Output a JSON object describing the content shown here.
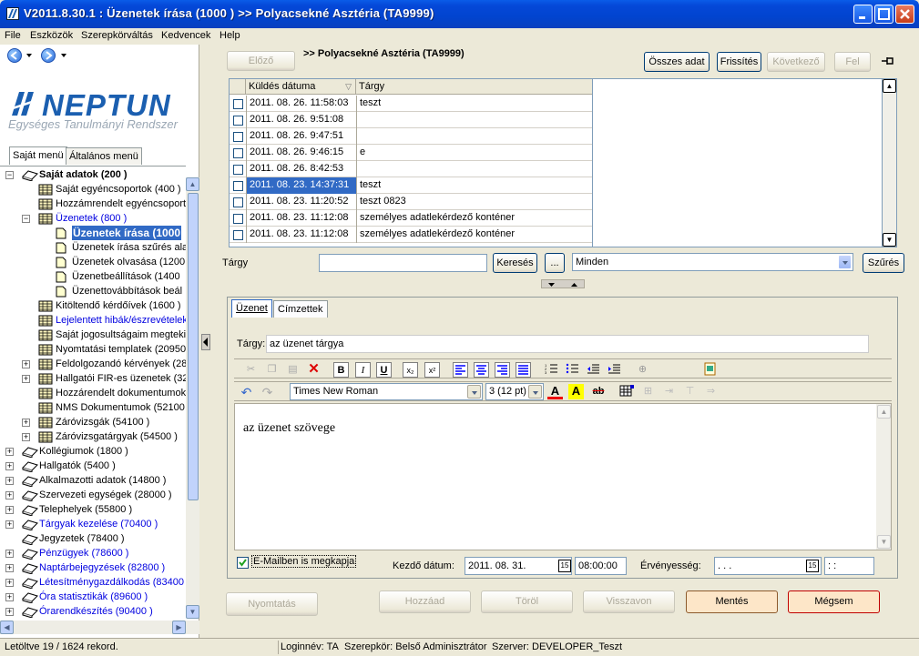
{
  "window": {
    "title": "V2011.8.30.1 : Üzenetek írása (1000  )  >> Polyacsekné Asztéria (TA9999)"
  },
  "menu": [
    "File",
    "Eszközök",
    "Szerepkörváltás",
    "Kedvencek",
    "Help"
  ],
  "logo": {
    "word": "NEPTUN",
    "sub": "Egységes Tanulmányi Rendszer"
  },
  "left_tabs": [
    "Saját menü",
    "Általános menü"
  ],
  "tree": [
    {
      "label": "Saját adatok (200  )",
      "level": 0,
      "bold": true,
      "exp": "−"
    },
    {
      "label": "Saját egyéncsoportok (400  )",
      "level": 1
    },
    {
      "label": "Hozzámrendelt egyéncsoporto",
      "level": 1
    },
    {
      "label": "Üzenetek (800  )",
      "level": 1,
      "blue": true,
      "exp": "−"
    },
    {
      "label": "Üzenetek írása (1000",
      "level": 2,
      "selected": true
    },
    {
      "label": "Üzenetek írása szűrés ala",
      "level": 2
    },
    {
      "label": "Üzenetek olvasása (1200",
      "level": 2
    },
    {
      "label": "Üzenetbeállítások (1400",
      "level": 2
    },
    {
      "label": "Üzenettovábbítások beál",
      "level": 2
    },
    {
      "label": "Kitöltendő kérdőívek (1600  )",
      "level": 1
    },
    {
      "label": "Lejelentett hibák/észrevételek",
      "level": 1,
      "blue": true
    },
    {
      "label": "Saját jogosultságaim megtekir",
      "level": 1
    },
    {
      "label": "Nyomtatási templatek (20950",
      "level": 1
    },
    {
      "label": "Feldolgozandó kérvények (28",
      "level": 1,
      "exp": "+"
    },
    {
      "label": "Hallgatói FIR-es üzenetek (32",
      "level": 1,
      "exp": "+"
    },
    {
      "label": "Hozzárendelt dokumentumok",
      "level": 1
    },
    {
      "label": "NMS Dokumentumok (52100",
      "level": 1
    },
    {
      "label": "Záróvizsgák (54100  )",
      "level": 1,
      "exp": "+"
    },
    {
      "label": "Záróvizsgatárgyak (54500  )",
      "level": 1,
      "exp": "+"
    },
    {
      "label": "Kollégiumok (1800  )",
      "level": 0,
      "exp": "+"
    },
    {
      "label": "Hallgatók (5400  )",
      "level": 0,
      "exp": "+"
    },
    {
      "label": "Alkalmazotti adatok (14800  )",
      "level": 0,
      "exp": "+"
    },
    {
      "label": "Szervezeti egységek (28000  )",
      "level": 0,
      "exp": "+"
    },
    {
      "label": "Telephelyek (55800  )",
      "level": 0,
      "exp": "+"
    },
    {
      "label": "Tárgyak kezelése (70400  )",
      "level": 0,
      "blue": true,
      "exp": "+"
    },
    {
      "label": "Jegyzetek (78400  )",
      "level": 0
    },
    {
      "label": "Pénzügyek (78600  )",
      "level": 0,
      "blue": true,
      "exp": "+"
    },
    {
      "label": "Naptárbejegyzések (82800  )",
      "level": 0,
      "blue": true,
      "exp": "+"
    },
    {
      "label": "Létesítménygazdálkodás (83400",
      "level": 0,
      "blue": true,
      "exp": "+"
    },
    {
      "label": "Óra statisztikák (89600  )",
      "level": 0,
      "blue": true,
      "exp": "+"
    },
    {
      "label": "Órarendkészítés (90400  )",
      "level": 0,
      "blue": true,
      "exp": "+"
    }
  ],
  "top": {
    "prev": "Előző",
    "breadcrumb": ">> Polyacsekné Asztéria (TA9999)",
    "all_data": "Összes adat",
    "refresh": "Frissítés",
    "next": "Következő",
    "up": "Fel"
  },
  "grid": {
    "headers": [
      "Küldés dátuma",
      "Tárgy"
    ],
    "rows": [
      [
        "2011. 08. 26. 11:58:03",
        "teszt"
      ],
      [
        "2011. 08. 26. 9:51:08",
        ""
      ],
      [
        "2011. 08. 26. 9:47:51",
        ""
      ],
      [
        "2011. 08. 26. 9:46:15",
        "e"
      ],
      [
        "2011. 08. 26. 8:42:53",
        ""
      ],
      [
        "2011. 08. 23. 14:37:31",
        "teszt"
      ],
      [
        "2011. 08. 23. 11:20:52",
        "teszt 0823"
      ],
      [
        "2011. 08. 23. 11:12:08",
        "személyes adatlekérdező konténer"
      ],
      [
        "2011. 08. 23. 11:12:08",
        "személyes adatlekérdező konténer"
      ]
    ],
    "selected_index": 5
  },
  "search": {
    "label": "Tárgy",
    "value": "",
    "search_btn": "Keresés",
    "dots_btn": "...",
    "filter_value": "Minden",
    "filter_btn": "Szűrés"
  },
  "message_tabs": [
    "Üzenet",
    "Címzettek"
  ],
  "subject": {
    "label": "Tárgy:",
    "value": "az üzenet tárgya"
  },
  "editor": {
    "font": "Times New Roman",
    "size": "3 (12 pt)",
    "body": "az üzenet szövege"
  },
  "footer": {
    "email_label": "E-Mailben is megkapja",
    "start_label": "Kezdő dátum:",
    "start_date": "2011. 08. 31.",
    "start_time": "08:00:00",
    "valid_label": "Érvényesség:",
    "valid_date": " .   .   .",
    "valid_time": " :  :",
    "cal_icon": "15"
  },
  "actions": {
    "print": "Nyomtatás",
    "add": "Hozzáad",
    "delete": "Töröl",
    "revoke": "Visszavon",
    "save": "Mentés",
    "cancel": "Mégsem"
  },
  "status": {
    "records": "Letöltve 19 / 1624 rekord.",
    "login": "Loginnév: TA",
    "role": "Szerepkör: Belső Adminisztrátor",
    "server": "Szerver: DEVELOPER_Teszt"
  },
  "colors": {
    "accent": "#316ac5",
    "save_bg": "#fde6c8",
    "cancel_border": "#c00000"
  }
}
